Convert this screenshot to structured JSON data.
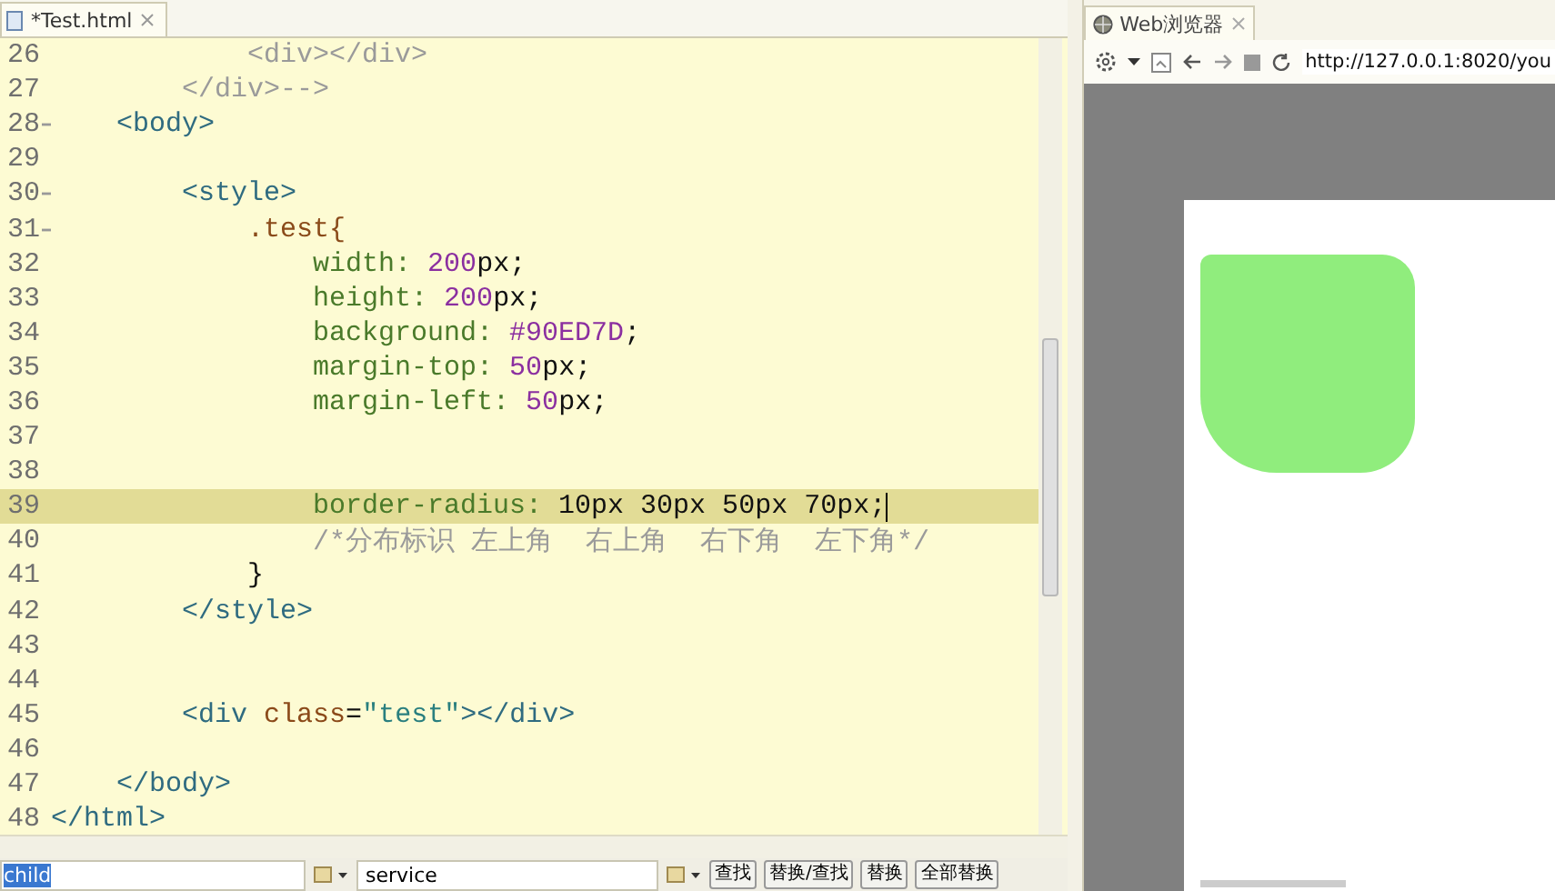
{
  "editor": {
    "tab_title": "*Test.html",
    "lines": [
      {
        "number": "26",
        "foldable": false,
        "current": false,
        "segments": [
          {
            "kind": "comment",
            "text": "            <div></div>"
          }
        ]
      },
      {
        "number": "27",
        "foldable": false,
        "current": false,
        "segments": [
          {
            "kind": "comment",
            "text": "        </div>-->"
          }
        ]
      },
      {
        "number": "28",
        "foldable": true,
        "current": false,
        "segments": [
          {
            "kind": "tag",
            "text": "    <body>"
          }
        ]
      },
      {
        "number": "29",
        "foldable": false,
        "current": false
      },
      {
        "number": "30",
        "foldable": true,
        "current": false,
        "segments": [
          {
            "kind": "tag",
            "text": "        <style>"
          }
        ]
      },
      {
        "number": "31",
        "foldable": true,
        "current": false,
        "segments": [
          {
            "kind": "selector",
            "text": "            .test{"
          }
        ]
      },
      {
        "number": "32",
        "foldable": false,
        "current": false,
        "segments": [
          {
            "kind": "prop",
            "text": "                width: "
          },
          {
            "kind": "number",
            "text": "200"
          },
          {
            "kind": "plain",
            "text": "px;"
          }
        ]
      },
      {
        "number": "33",
        "foldable": false,
        "current": false,
        "segments": [
          {
            "kind": "prop",
            "text": "                height: "
          },
          {
            "kind": "number",
            "text": "200"
          },
          {
            "kind": "plain",
            "text": "px;"
          }
        ]
      },
      {
        "number": "34",
        "foldable": false,
        "current": false,
        "segments": [
          {
            "kind": "prop",
            "text": "                background: "
          },
          {
            "kind": "number",
            "text": "#90ED7D"
          },
          {
            "kind": "plain",
            "text": ";"
          }
        ]
      },
      {
        "number": "35",
        "foldable": false,
        "current": false,
        "segments": [
          {
            "kind": "prop",
            "text": "                margin-top: "
          },
          {
            "kind": "number",
            "text": "50"
          },
          {
            "kind": "plain",
            "text": "px;"
          }
        ]
      },
      {
        "number": "36",
        "foldable": false,
        "current": false,
        "segments": [
          {
            "kind": "prop",
            "text": "                margin-left: "
          },
          {
            "kind": "number",
            "text": "50"
          },
          {
            "kind": "plain",
            "text": "px;"
          }
        ]
      },
      {
        "number": "37",
        "foldable": false,
        "current": false
      },
      {
        "number": "38",
        "foldable": false,
        "current": false
      },
      {
        "number": "39",
        "foldable": false,
        "current": true,
        "segments": [
          {
            "kind": "prop",
            "text": "                border-radius: "
          },
          {
            "kind": "plain",
            "text": "10px 30px 50px 70px;"
          }
        ]
      },
      {
        "number": "40",
        "foldable": false,
        "current": false,
        "segments": [
          {
            "kind": "comment",
            "text": "                /*分布标识 左上角  右上角  右下角  左下角*/"
          }
        ]
      },
      {
        "number": "41",
        "foldable": false,
        "current": false,
        "segments": [
          {
            "kind": "plain",
            "text": "            }"
          }
        ]
      },
      {
        "number": "42",
        "foldable": false,
        "current": false,
        "segments": [
          {
            "kind": "tag",
            "text": "        </style>"
          }
        ]
      },
      {
        "number": "43",
        "foldable": false,
        "current": false
      },
      {
        "number": "44",
        "foldable": false,
        "current": false
      },
      {
        "number": "45",
        "foldable": false,
        "current": false,
        "segments": [
          {
            "kind": "tag",
            "text": "        <div "
          },
          {
            "kind": "attr",
            "text": "class"
          },
          {
            "kind": "plain",
            "text": "="
          },
          {
            "kind": "string",
            "text": "\"test\""
          },
          {
            "kind": "tag",
            "text": "></div>"
          }
        ]
      },
      {
        "number": "46",
        "foldable": false,
        "current": false
      },
      {
        "number": "47",
        "foldable": false,
        "current": false,
        "segments": [
          {
            "kind": "tag",
            "text": "    </body>"
          }
        ]
      },
      {
        "number": "48",
        "foldable": false,
        "current": false,
        "segments": [
          {
            "kind": "tag",
            "text": "</html>"
          }
        ]
      }
    ]
  },
  "find_bar": {
    "find_value": "child",
    "find_selected": true,
    "replace_value": "service",
    "buttons": [
      "查找",
      "替换/查找",
      "替换",
      "全部替换"
    ]
  },
  "browser": {
    "tab_title": "Web浏览器",
    "url": "http://127.0.0.1:8020/you"
  }
}
